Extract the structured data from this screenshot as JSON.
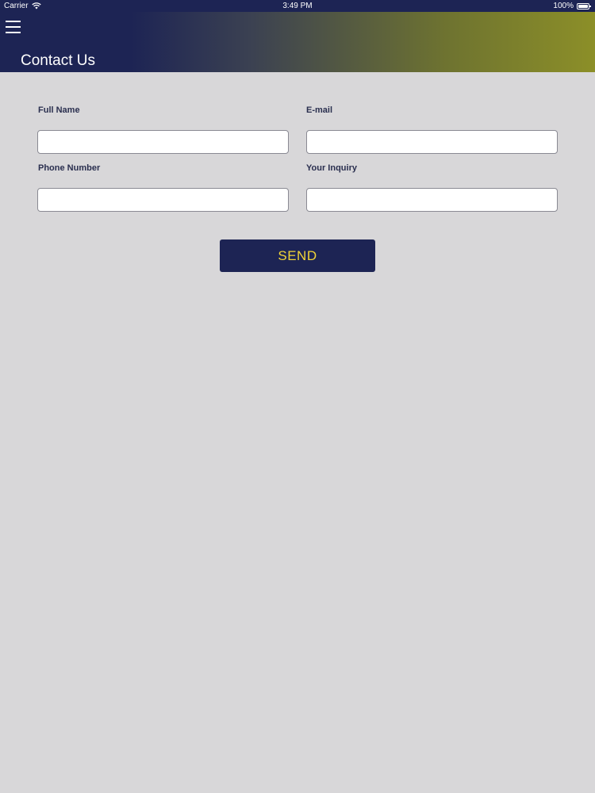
{
  "status_bar": {
    "carrier": "Carrier",
    "time": "3:49 PM",
    "battery": "100%"
  },
  "header": {
    "title": "Contact Us",
    "menu_icon": "hamburger-menu-icon"
  },
  "form": {
    "full_name_label": "Full Name",
    "email_label": "E-mail",
    "phone_label": "Phone Number",
    "inquiry_label": "Your Inquiry",
    "full_name_value": "",
    "email_value": "",
    "phone_value": "",
    "inquiry_value": ""
  },
  "actions": {
    "send_label": "SEND"
  },
  "colors": {
    "primary": "#1d2454",
    "accent": "#f2d437",
    "background": "#d8d7d9"
  }
}
